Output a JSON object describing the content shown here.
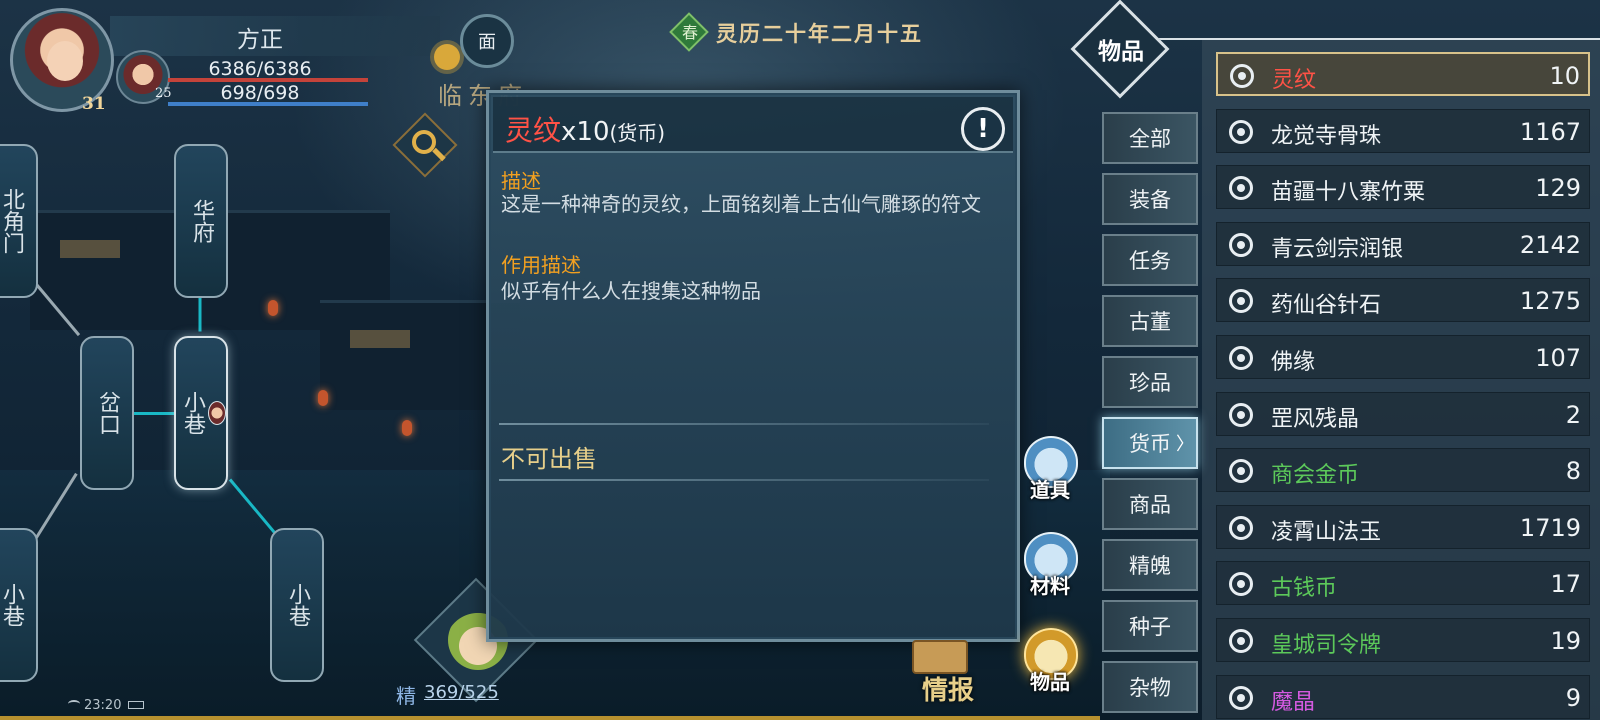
{
  "player": {
    "name": "方正",
    "level": "31",
    "hp": "6386/6386",
    "mp": "698/698",
    "companion_level": "25"
  },
  "location": {
    "title": "临东府",
    "mask_char": "面"
  },
  "date": {
    "season": "春",
    "text": "灵历二十年二月十五"
  },
  "map": {
    "nodes": [
      "北角门",
      "华府",
      "岔口",
      "小巷",
      "小巷",
      "小巷"
    ]
  },
  "hud": {
    "energy_label": "精",
    "energy": "369/525",
    "time": "23:20",
    "intel_label": "情报"
  },
  "detail": {
    "item_name": "灵纹",
    "item_qty": "x10",
    "item_category": "(货币)",
    "warn_icon": "!",
    "desc_label": "描述",
    "desc_text": "这是一种神奇的灵纹，上面铭刻着上古仙气雕琢的符文",
    "effect_label": "作用描述",
    "effect_text": "似乎有什么人在搜集这种物品",
    "sell_text": "不可出售"
  },
  "bags": [
    {
      "label": "道具",
      "icon": "tool-bag-icon"
    },
    {
      "label": "材料",
      "icon": "material-bag-icon"
    },
    {
      "label": "物品",
      "icon": "item-bag-icon",
      "active": true
    }
  ],
  "inventory": {
    "title": "物品",
    "tabs": [
      "全部",
      "装备",
      "任务",
      "古董",
      "珍品",
      "货币",
      "商品",
      "精魄",
      "种子",
      "杂物"
    ],
    "active_tab": "货币",
    "items": [
      {
        "name": "灵纹",
        "count": "10",
        "color": "#ff5246"
      },
      {
        "name": "龙觉寺骨珠",
        "count": "1167",
        "color": "#f0f4f6"
      },
      {
        "name": "苗疆十八寨竹粟",
        "count": "129",
        "color": "#f0f4f6"
      },
      {
        "name": "青云剑宗润银",
        "count": "2142",
        "color": "#f0f4f6"
      },
      {
        "name": "药仙谷针石",
        "count": "1275",
        "color": "#f0f4f6"
      },
      {
        "name": "佛缘",
        "count": "107",
        "color": "#f0f4f6"
      },
      {
        "name": "罡风残晶",
        "count": "2",
        "color": "#f0f4f6"
      },
      {
        "name": "商会金币",
        "count": "8",
        "color": "#5cc95a"
      },
      {
        "name": "凌霄山法玉",
        "count": "1719",
        "color": "#f0f4f6"
      },
      {
        "name": "古钱币",
        "count": "17",
        "color": "#5cc95a"
      },
      {
        "name": "皇城司令牌",
        "count": "19",
        "color": "#5cc95a"
      },
      {
        "name": "魔晶",
        "count": "9",
        "color": "#d45ae0"
      }
    ]
  }
}
